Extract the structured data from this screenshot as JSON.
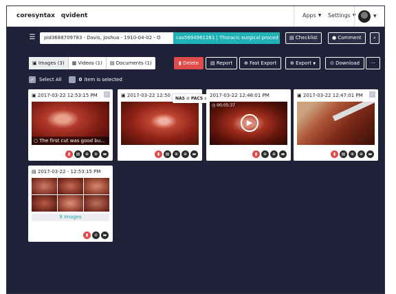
{
  "app": {
    "logo_left": "coresyntax",
    "logo_right": "qvident",
    "menu_apps": "Apps",
    "menu_settings": "Settings"
  },
  "patient": {
    "text": "pid3688709783 - Davis, Joshua - 1910-04-02 - O",
    "case": "cas5694981281 | Thoracic surgical proced"
  },
  "toolbar": {
    "checklist": "Checklist",
    "comment": "Comment"
  },
  "tabs": [
    {
      "label": "Images (3)",
      "icon": "image-icon"
    },
    {
      "label": "Videos (1)",
      "icon": "video-icon"
    },
    {
      "label": "Documents (1)",
      "icon": "document-icon"
    }
  ],
  "actions": {
    "delete": "Delete",
    "report": "Report",
    "fast_export": "Fast Export",
    "export": "Export",
    "download": "Download",
    "more": "···"
  },
  "selection": {
    "select_all": "Select All",
    "count": "0",
    "count_text": "item is selected"
  },
  "cards": [
    {
      "type": "image",
      "timestamp": "2017-03-22 12:53:15 PM",
      "caption": "The first cut was good bu..."
    },
    {
      "type": "image",
      "timestamp": "2017-03-22 12:50"
    },
    {
      "type": "video",
      "timestamp": "2017-03-22 12:48:01 PM",
      "duration": "00:05:37"
    },
    {
      "type": "image",
      "timestamp": "2017-03-22 12:47:01 PM"
    },
    {
      "type": "document",
      "timestamp": "2017-03-22 - 12:53:15 PM",
      "images_label": "Images",
      "images_count": "9"
    }
  ],
  "popover": {
    "nas": "NAS",
    "pacs": "PACS"
  },
  "colors": {
    "background": "#1f2238",
    "accent": "#1fb1b6",
    "danger": "#e04b4b"
  }
}
